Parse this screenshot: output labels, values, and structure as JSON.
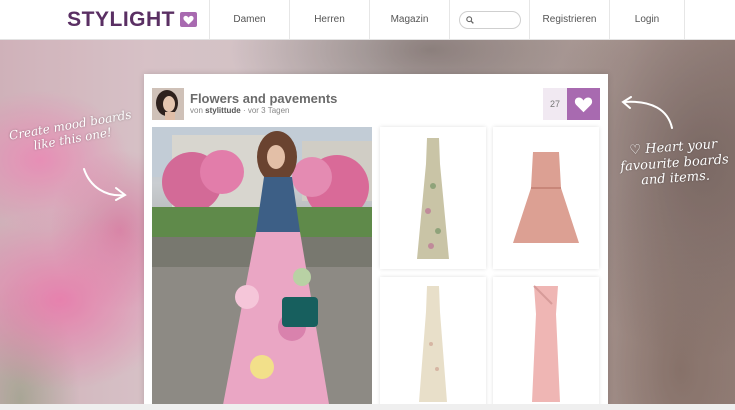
{
  "header": {
    "logo": "STYLIGHT",
    "nav": {
      "damen": "Damen",
      "herren": "Herren",
      "magazin": "Magazin",
      "registrieren": "Registrieren",
      "login": "Login"
    },
    "search_placeholder": ""
  },
  "board": {
    "title": "Flowers and pavements",
    "by_prefix": "von",
    "author": "stylittude",
    "time": "· vor 3 Tagen",
    "likes": "27"
  },
  "notes": {
    "left": "Create mood boards like this one!",
    "right": "♡ Heart your favourite boards and items."
  },
  "colors": {
    "brand": "#5a2f63",
    "accent": "#a86ab0"
  }
}
